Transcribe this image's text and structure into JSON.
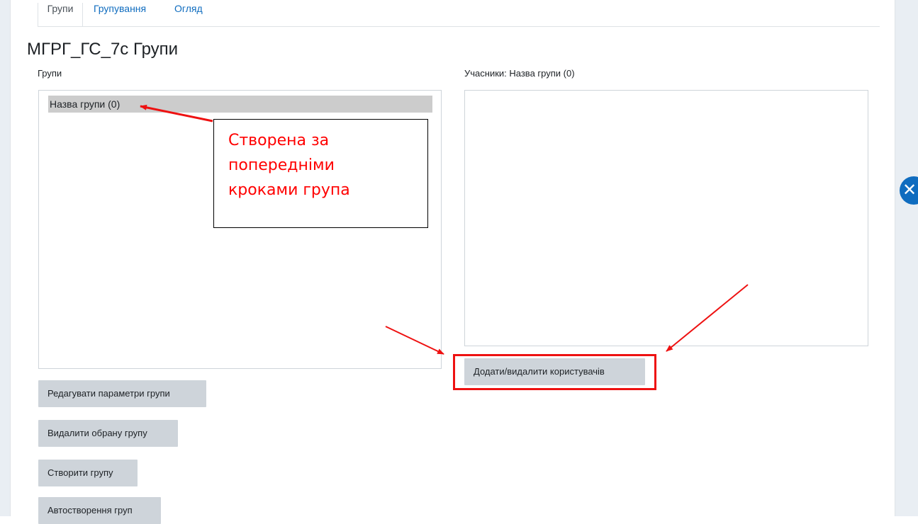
{
  "tabs": [
    {
      "label": "Групи",
      "active": true
    },
    {
      "label": "Групування",
      "active": false
    },
    {
      "label": "Огляд",
      "active": false
    }
  ],
  "page_title": "МГРГ_ГС_7с Групи",
  "groups_panel": {
    "label": "Групи",
    "options": [
      "Назва групи (0)"
    ],
    "selected": "Назва групи (0)"
  },
  "members_panel": {
    "label": "Учасники: Назва групи (0)",
    "options": []
  },
  "buttons": {
    "edit_group": "Редагувати параметри групи",
    "delete_group": "Видалити обрану групу",
    "create_group": "Створити групу",
    "auto_create": "Автостворення груп",
    "add_remove_users": "Додати/видалити користувачів"
  },
  "annotation": {
    "callout_lines": [
      "Створена за",
      "попередніми",
      "кроками група"
    ],
    "color": "#ff0000"
  },
  "colors": {
    "link": "#0f6cbf",
    "button_bg": "#ced4da",
    "selected_option_bg": "#cccccc",
    "drawer_toggle": "#0f6cbf"
  },
  "icons": {
    "drawer_toggle": "close-x-icon"
  }
}
